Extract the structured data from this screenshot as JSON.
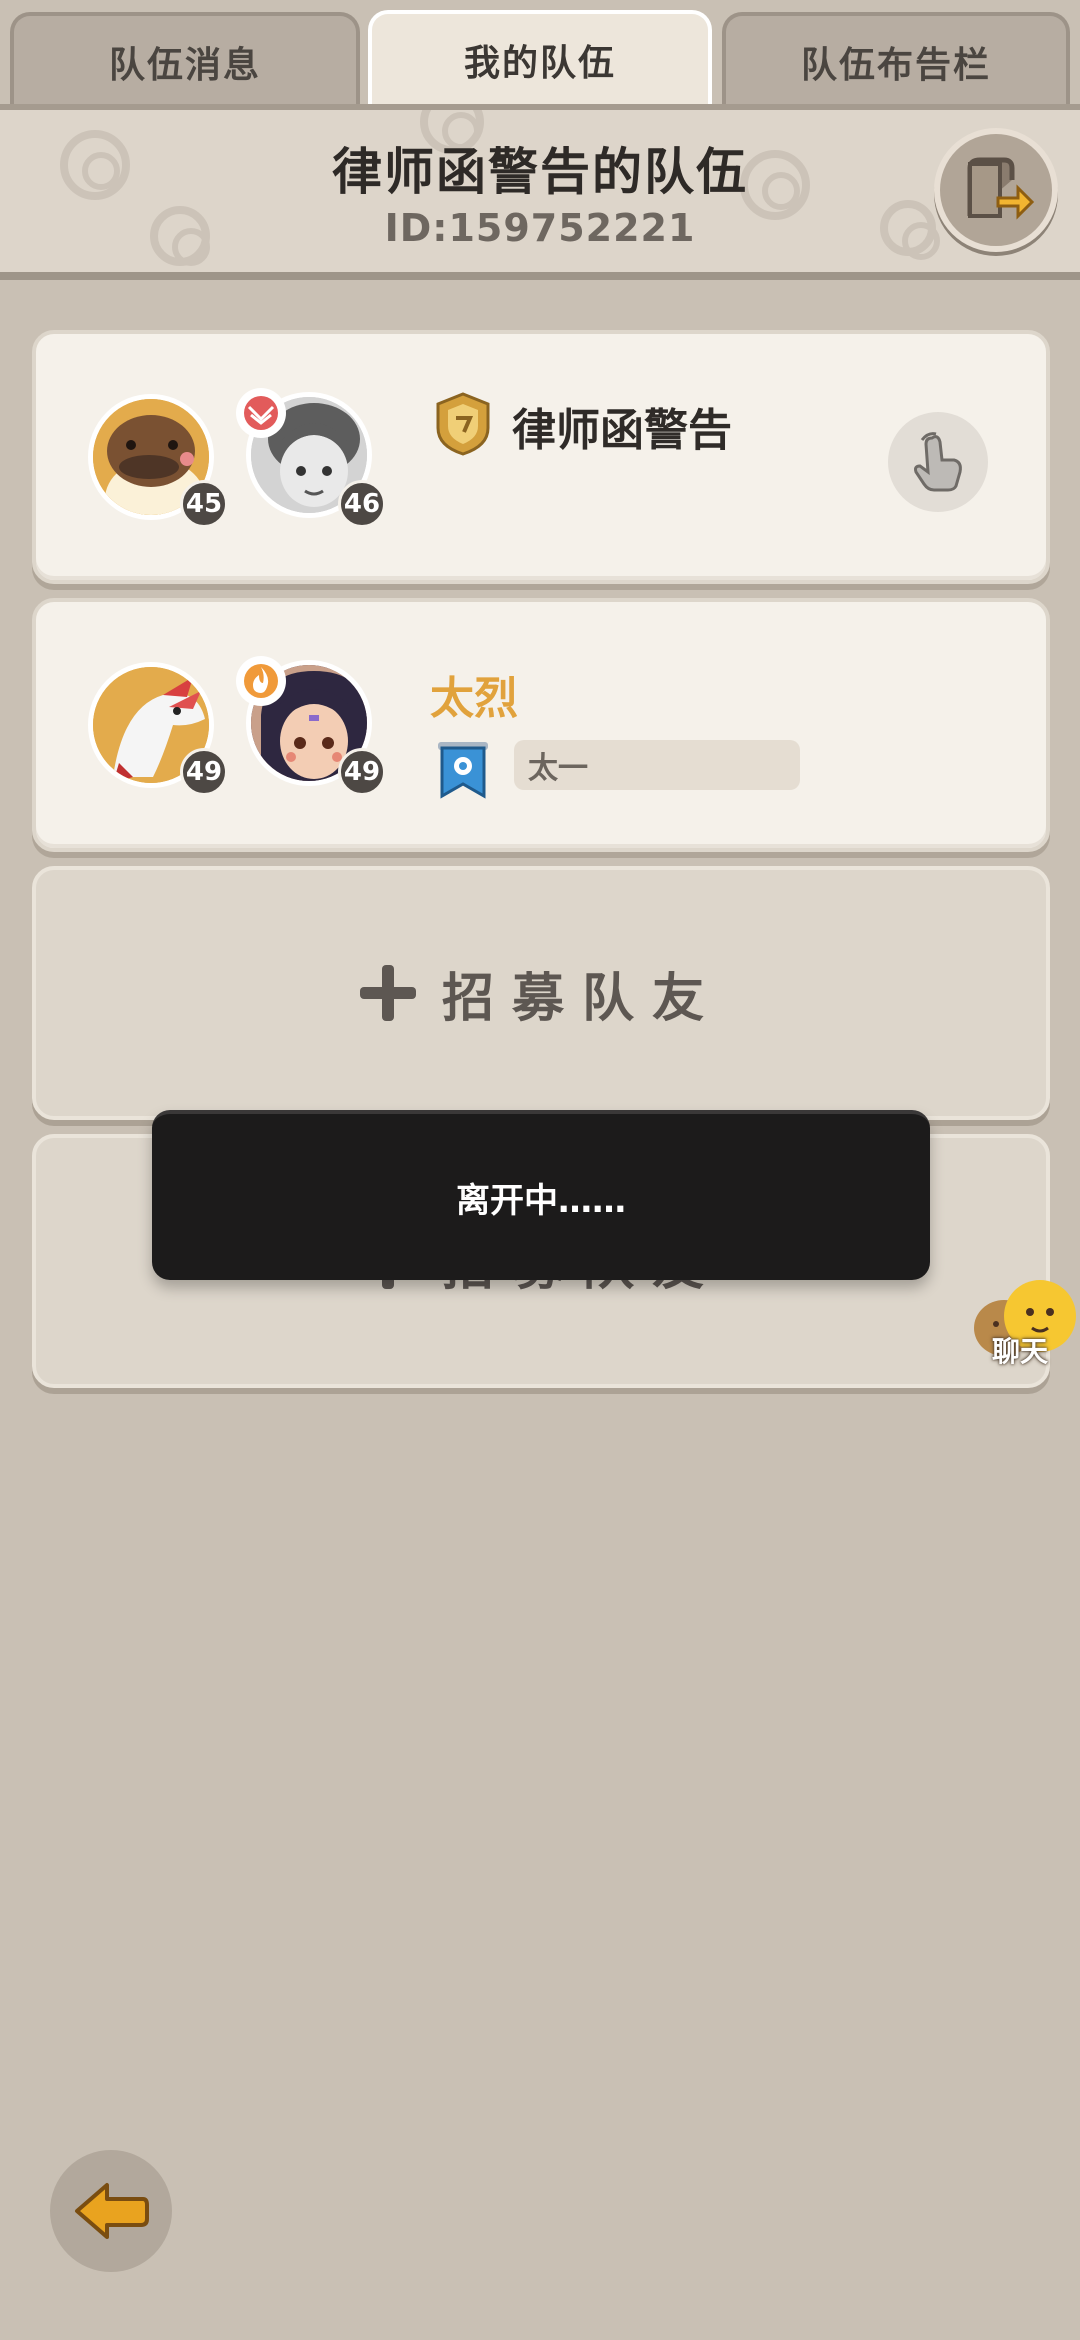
{
  "tabs": [
    {
      "label": "队伍消息",
      "active": false
    },
    {
      "label": "我的队伍",
      "active": true
    },
    {
      "label": "队伍布告栏",
      "active": false
    }
  ],
  "header": {
    "title": "律师函警告的队伍",
    "id_text": "ID:159752221"
  },
  "members": [
    {
      "name": "律师函警告",
      "pet_level": "45",
      "player_level": "46",
      "rank_icon": "gold-shield-badge-icon",
      "role_icon": "red-wing-badge-icon",
      "action_icon": "tap-hand-icon"
    },
    {
      "name": "太烈",
      "pet_level": "49",
      "player_level": "49",
      "tag": "太一",
      "tag_icon": "blue-banner-icon",
      "role_icon": "orange-flame-badge-icon"
    }
  ],
  "recruit_label": "招募队友",
  "toast": "离开中……",
  "chat_label": "聊天",
  "colors": {
    "background": "#c9c0b4",
    "card": "#f5f1ea",
    "empty_card": "#ddd6cb",
    "gold_name": "#e1a23c",
    "toast": "#1c1b1b",
    "back_arrow": "#e9a31f"
  }
}
